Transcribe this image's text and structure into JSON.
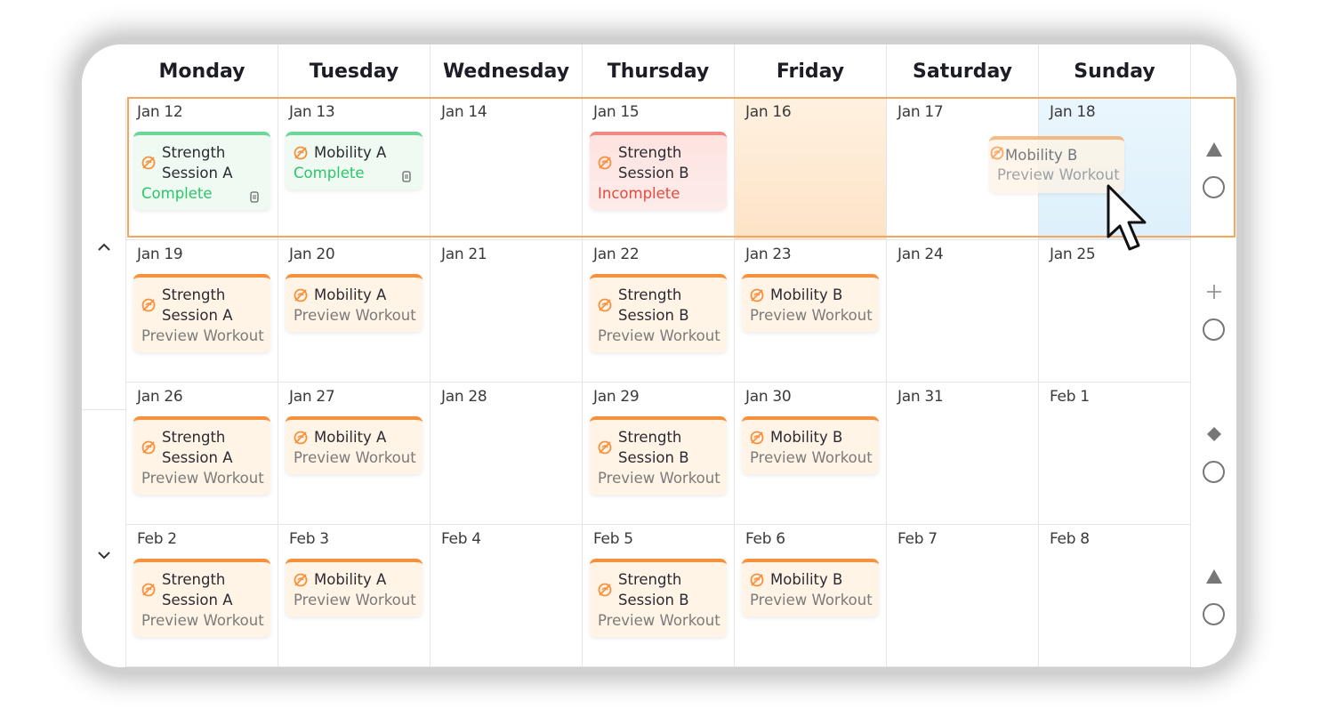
{
  "days": [
    "Monday",
    "Tuesday",
    "Wednesday",
    "Thursday",
    "Friday",
    "Saturday",
    "Sunday"
  ],
  "weeks": [
    {
      "cells": [
        {
          "date": "Jan 12",
          "card": {
            "title": "Strength Session A",
            "status": "Complete",
            "variant": "green",
            "trash": true
          }
        },
        {
          "date": "Jan 13",
          "card": {
            "title": "Mobility A",
            "status": "Complete",
            "variant": "green",
            "trash": true
          }
        },
        {
          "date": "Jan 14"
        },
        {
          "date": "Jan 15",
          "card": {
            "title": "Strength Session B",
            "status": "Incomplete",
            "variant": "red"
          }
        },
        {
          "date": "Jan 16",
          "highlight": "friday"
        },
        {
          "date": "Jan 17"
        },
        {
          "date": "Jan 18",
          "highlight": "sunday"
        }
      ]
    },
    {
      "cells": [
        {
          "date": "Jan 19",
          "card": {
            "title": "Strength Session A",
            "status": "Preview Workout",
            "variant": "orange"
          }
        },
        {
          "date": "Jan 20",
          "card": {
            "title": "Mobility A",
            "status": "Preview Workout",
            "variant": "orange"
          }
        },
        {
          "date": "Jan 21"
        },
        {
          "date": "Jan 22",
          "card": {
            "title": "Strength Session B",
            "status": "Preview Workout",
            "variant": "orange"
          }
        },
        {
          "date": "Jan 23",
          "card": {
            "title": "Mobility B",
            "status": "Preview Workout",
            "variant": "orange"
          }
        },
        {
          "date": "Jan 24"
        },
        {
          "date": "Jan 25"
        }
      ]
    },
    {
      "cells": [
        {
          "date": "Jan 26",
          "card": {
            "title": "Strength Session A",
            "status": "Preview Workout",
            "variant": "orange"
          }
        },
        {
          "date": "Jan 27",
          "card": {
            "title": "Mobility A",
            "status": "Preview Workout",
            "variant": "orange"
          }
        },
        {
          "date": "Jan 28"
        },
        {
          "date": "Jan 29",
          "card": {
            "title": "Strength Session B",
            "status": "Preview Workout",
            "variant": "orange"
          }
        },
        {
          "date": "Jan 30",
          "card": {
            "title": "Mobility B",
            "status": "Preview Workout",
            "variant": "orange"
          }
        },
        {
          "date": "Jan 31"
        },
        {
          "date": "Feb 1"
        }
      ]
    },
    {
      "cells": [
        {
          "date": "Feb 2",
          "card": {
            "title": "Strength Session A",
            "status": "Preview Workout",
            "variant": "orange"
          }
        },
        {
          "date": "Feb 3",
          "card": {
            "title": "Mobility A",
            "status": "Preview Workout",
            "variant": "orange"
          }
        },
        {
          "date": "Feb 4"
        },
        {
          "date": "Feb 5",
          "card": {
            "title": "Strength Session B",
            "status": "Preview Workout",
            "variant": "orange"
          }
        },
        {
          "date": "Feb 6",
          "card": {
            "title": "Mobility B",
            "status": "Preview Workout",
            "variant": "orange"
          }
        },
        {
          "date": "Feb 7"
        },
        {
          "date": "Feb 8"
        }
      ]
    }
  ],
  "drag_ghost": {
    "title": "Mobility B",
    "status": "Preview Workout"
  },
  "left_nav": {
    "up_icon": "chevron-up-icon",
    "down_icon": "chevron-down-icon"
  },
  "right_markers": [
    "triangle-icon",
    "plus-icon",
    "diamond-icon",
    "triangle-icon"
  ],
  "colors": {
    "accent": "#f7913d",
    "complete": "#2dc56a",
    "incomplete": "#e84a3b",
    "selection": "#f6a55c"
  }
}
